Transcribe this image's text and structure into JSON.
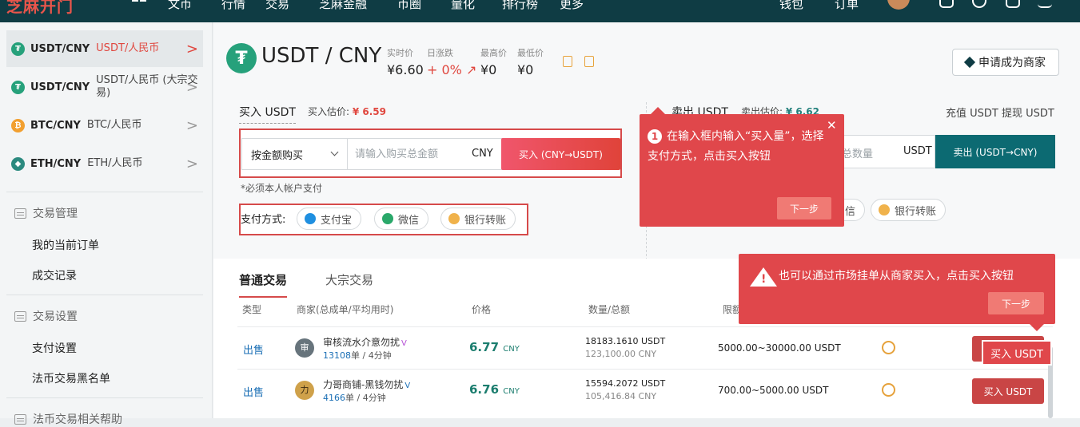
{
  "header": {
    "nav": [
      "文币",
      "行情",
      "交易",
      "芝麻金融",
      "币圈",
      "量化",
      "排行榜",
      "更多"
    ],
    "right": [
      "钱包",
      "订单"
    ]
  },
  "sidebar": {
    "pairs": [
      {
        "symbol": "USDT/CNY",
        "name": "USDT/人民币",
        "active": true,
        "color": "#26a17b",
        "glyph": "₮"
      },
      {
        "symbol": "USDT/CNY",
        "name": "USDT/人民币 (大宗交易)",
        "active": false,
        "color": "#26a17b",
        "glyph": "₮"
      },
      {
        "symbol": "BTC/CNY",
        "name": "BTC/人民币",
        "active": false,
        "color": "#f2a030",
        "glyph": "₿"
      },
      {
        "symbol": "ETH/CNY",
        "name": "ETH/人民币",
        "active": false,
        "color": "#2b8a7f",
        "glyph": "◆"
      }
    ],
    "chevron": ">",
    "sections": [
      {
        "title": "交易管理",
        "links": [
          "我的当前订单",
          "成交记录"
        ]
      },
      {
        "title": "交易设置",
        "links": [
          "支付设置",
          "法币交易黑名单"
        ]
      },
      {
        "title": "法币交易相关帮助",
        "links": []
      }
    ]
  },
  "pair": {
    "title": "USDT / CNY",
    "stats": [
      {
        "label": "实时价",
        "value": "¥6.60"
      },
      {
        "label": "日涨跌",
        "value": "+ 0% ↗"
      },
      {
        "label": "最高价",
        "value": "¥0"
      },
      {
        "label": "最低价",
        "value": "¥0"
      }
    ],
    "merchant_label": "申请成为商家"
  },
  "buy": {
    "title": "买入 USDT",
    "est_label": "买入估价:",
    "est_value": "¥ 6.59",
    "mode": "按金额购买",
    "placeholder": "请输入购买总金额",
    "unit": "CNY",
    "button": "买入 (CNY→USDT)",
    "note": "*必须本人帐户支付",
    "pay_label": "支付方式:",
    "pay_methods": [
      "支付宝",
      "微信",
      "银行转账"
    ]
  },
  "sell": {
    "title": "卖出 USDT",
    "est_label": "卖出估价:",
    "est_value": "¥ 6.62",
    "links": "充值 USDT  提现 USDT",
    "placeholder": "总数量",
    "unit": "USDT",
    "button": "卖出 (USDT→CNY)",
    "pay_partial": [
      "信",
      "银行转账"
    ]
  },
  "trade": {
    "tabs": [
      "普通交易",
      "大宗交易"
    ],
    "headers": [
      "类型",
      "商家(总成单/平均用时)",
      "价格",
      "数量/总额",
      "限额"
    ],
    "rows": [
      {
        "type": "出售",
        "merchant": "审核流水介意勿扰",
        "orders": "13108",
        "suffix": "单 / 4分钟",
        "price": "6.77",
        "currency": "CNY",
        "qty": "18183.1610 USDT",
        "total": "123,100.00 CNY",
        "limit": "5000.00~30000.00 USDT",
        "button": "买入 USDT",
        "avatar_glyph": "审"
      },
      {
        "type": "出售",
        "merchant": "力哥商铺-黑钱勿扰",
        "orders": "4166",
        "suffix": "单 / 4分钟",
        "price": "6.76",
        "currency": "CNY",
        "qty": "15594.2072 USDT",
        "total": "105,416.84 CNY",
        "limit": "700.00~5000.00 USDT",
        "button": "买入 USDT",
        "avatar_glyph": "力"
      }
    ]
  },
  "tooltips": {
    "step1_num": "1",
    "step1": "在输入框内输入“买入量”，选择支付方式，点击买入按钮",
    "step1_next": "下一步",
    "step1_close": "✕",
    "step2": "也可以通过市场挂单从商家买入，点击买入按钮",
    "step2_next": "下一步",
    "highlight_buy": "买入 USDT"
  }
}
